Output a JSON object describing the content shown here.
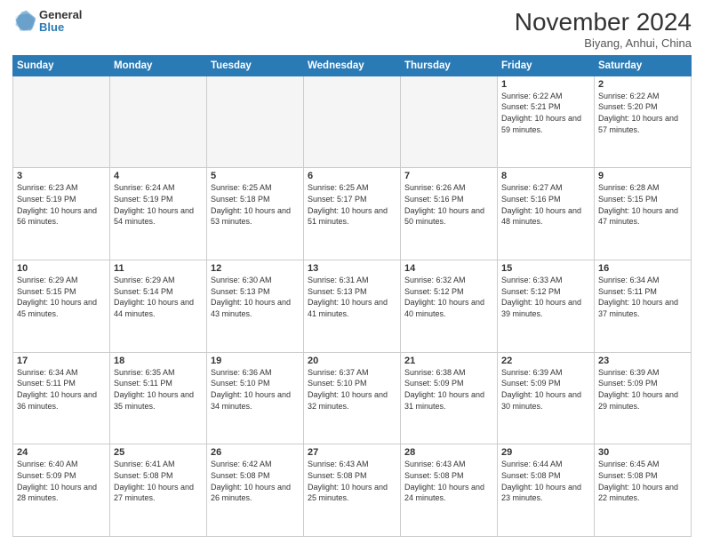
{
  "logo": {
    "general": "General",
    "blue": "Blue"
  },
  "header": {
    "month": "November 2024",
    "location": "Biyang, Anhui, China"
  },
  "days": [
    "Sunday",
    "Monday",
    "Tuesday",
    "Wednesday",
    "Thursday",
    "Friday",
    "Saturday"
  ],
  "weeks": [
    [
      {
        "day": "",
        "empty": true
      },
      {
        "day": "",
        "empty": true
      },
      {
        "day": "",
        "empty": true
      },
      {
        "day": "",
        "empty": true
      },
      {
        "day": "",
        "empty": true
      },
      {
        "day": "1",
        "sunrise": "6:22 AM",
        "sunset": "5:21 PM",
        "daylight": "10 hours and 59 minutes."
      },
      {
        "day": "2",
        "sunrise": "6:22 AM",
        "sunset": "5:20 PM",
        "daylight": "10 hours and 57 minutes."
      }
    ],
    [
      {
        "day": "3",
        "sunrise": "6:23 AM",
        "sunset": "5:19 PM",
        "daylight": "10 hours and 56 minutes."
      },
      {
        "day": "4",
        "sunrise": "6:24 AM",
        "sunset": "5:19 PM",
        "daylight": "10 hours and 54 minutes."
      },
      {
        "day": "5",
        "sunrise": "6:25 AM",
        "sunset": "5:18 PM",
        "daylight": "10 hours and 53 minutes."
      },
      {
        "day": "6",
        "sunrise": "6:25 AM",
        "sunset": "5:17 PM",
        "daylight": "10 hours and 51 minutes."
      },
      {
        "day": "7",
        "sunrise": "6:26 AM",
        "sunset": "5:16 PM",
        "daylight": "10 hours and 50 minutes."
      },
      {
        "day": "8",
        "sunrise": "6:27 AM",
        "sunset": "5:16 PM",
        "daylight": "10 hours and 48 minutes."
      },
      {
        "day": "9",
        "sunrise": "6:28 AM",
        "sunset": "5:15 PM",
        "daylight": "10 hours and 47 minutes."
      }
    ],
    [
      {
        "day": "10",
        "sunrise": "6:29 AM",
        "sunset": "5:15 PM",
        "daylight": "10 hours and 45 minutes."
      },
      {
        "day": "11",
        "sunrise": "6:29 AM",
        "sunset": "5:14 PM",
        "daylight": "10 hours and 44 minutes."
      },
      {
        "day": "12",
        "sunrise": "6:30 AM",
        "sunset": "5:13 PM",
        "daylight": "10 hours and 43 minutes."
      },
      {
        "day": "13",
        "sunrise": "6:31 AM",
        "sunset": "5:13 PM",
        "daylight": "10 hours and 41 minutes."
      },
      {
        "day": "14",
        "sunrise": "6:32 AM",
        "sunset": "5:12 PM",
        "daylight": "10 hours and 40 minutes."
      },
      {
        "day": "15",
        "sunrise": "6:33 AM",
        "sunset": "5:12 PM",
        "daylight": "10 hours and 39 minutes."
      },
      {
        "day": "16",
        "sunrise": "6:34 AM",
        "sunset": "5:11 PM",
        "daylight": "10 hours and 37 minutes."
      }
    ],
    [
      {
        "day": "17",
        "sunrise": "6:34 AM",
        "sunset": "5:11 PM",
        "daylight": "10 hours and 36 minutes."
      },
      {
        "day": "18",
        "sunrise": "6:35 AM",
        "sunset": "5:11 PM",
        "daylight": "10 hours and 35 minutes."
      },
      {
        "day": "19",
        "sunrise": "6:36 AM",
        "sunset": "5:10 PM",
        "daylight": "10 hours and 34 minutes."
      },
      {
        "day": "20",
        "sunrise": "6:37 AM",
        "sunset": "5:10 PM",
        "daylight": "10 hours and 32 minutes."
      },
      {
        "day": "21",
        "sunrise": "6:38 AM",
        "sunset": "5:09 PM",
        "daylight": "10 hours and 31 minutes."
      },
      {
        "day": "22",
        "sunrise": "6:39 AM",
        "sunset": "5:09 PM",
        "daylight": "10 hours and 30 minutes."
      },
      {
        "day": "23",
        "sunrise": "6:39 AM",
        "sunset": "5:09 PM",
        "daylight": "10 hours and 29 minutes."
      }
    ],
    [
      {
        "day": "24",
        "sunrise": "6:40 AM",
        "sunset": "5:09 PM",
        "daylight": "10 hours and 28 minutes."
      },
      {
        "day": "25",
        "sunrise": "6:41 AM",
        "sunset": "5:08 PM",
        "daylight": "10 hours and 27 minutes."
      },
      {
        "day": "26",
        "sunrise": "6:42 AM",
        "sunset": "5:08 PM",
        "daylight": "10 hours and 26 minutes."
      },
      {
        "day": "27",
        "sunrise": "6:43 AM",
        "sunset": "5:08 PM",
        "daylight": "10 hours and 25 minutes."
      },
      {
        "day": "28",
        "sunrise": "6:43 AM",
        "sunset": "5:08 PM",
        "daylight": "10 hours and 24 minutes."
      },
      {
        "day": "29",
        "sunrise": "6:44 AM",
        "sunset": "5:08 PM",
        "daylight": "10 hours and 23 minutes."
      },
      {
        "day": "30",
        "sunrise": "6:45 AM",
        "sunset": "5:08 PM",
        "daylight": "10 hours and 22 minutes."
      }
    ]
  ]
}
